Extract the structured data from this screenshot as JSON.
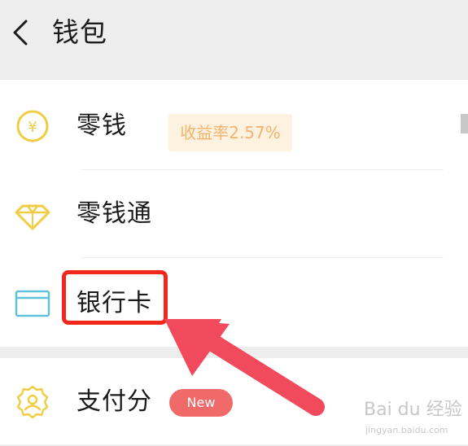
{
  "nav": {
    "title": "钱包"
  },
  "rows": [
    {
      "label": "零钱",
      "icon": "yuan-coin-icon"
    },
    {
      "label": "零钱通",
      "icon": "diamond-icon",
      "badge": "收益率2.57%"
    },
    {
      "label": "银行卡",
      "icon": "bank-card-icon"
    },
    {
      "label": "支付分",
      "icon": "score-badge-icon",
      "badge": "New"
    }
  ],
  "annotation": {
    "arrow_color": "#f04a5c",
    "box_color": "#f2271c"
  },
  "watermark": {
    "text": "Bai du 经验",
    "url": "jingyan.baidu.com"
  },
  "colors": {
    "icon_yellow": "#f1cd45",
    "icon_blue": "#5fc2d8",
    "badge_orange": "#f2b56d",
    "new_red": "#f06a6a"
  }
}
